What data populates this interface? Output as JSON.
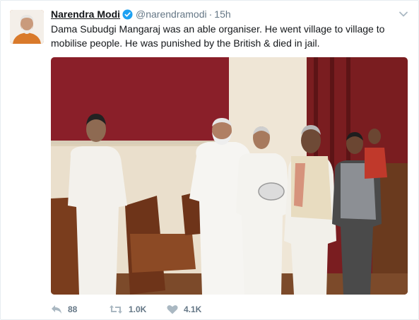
{
  "tweet": {
    "display_name": "Narendra Modi",
    "handle": "@narendramodi",
    "separator": "·",
    "time": "15h",
    "text": "Dama Subudgi Mangaraj was an able organiser. He went village to village to mobilise people. He was punished by the British & died in jail."
  },
  "actions": {
    "replies": "88",
    "retweets": "1.0K",
    "likes": "4.1K"
  },
  "icons": {
    "verified": "verified-badge-icon",
    "menu": "chevron-down-icon",
    "reply": "reply-icon",
    "retweet": "retweet-icon",
    "like": "heart-icon"
  },
  "colors": {
    "name": "#14171a",
    "secondary": "#657786",
    "verified": "#1da1f2",
    "icon": "#aab8c2"
  }
}
